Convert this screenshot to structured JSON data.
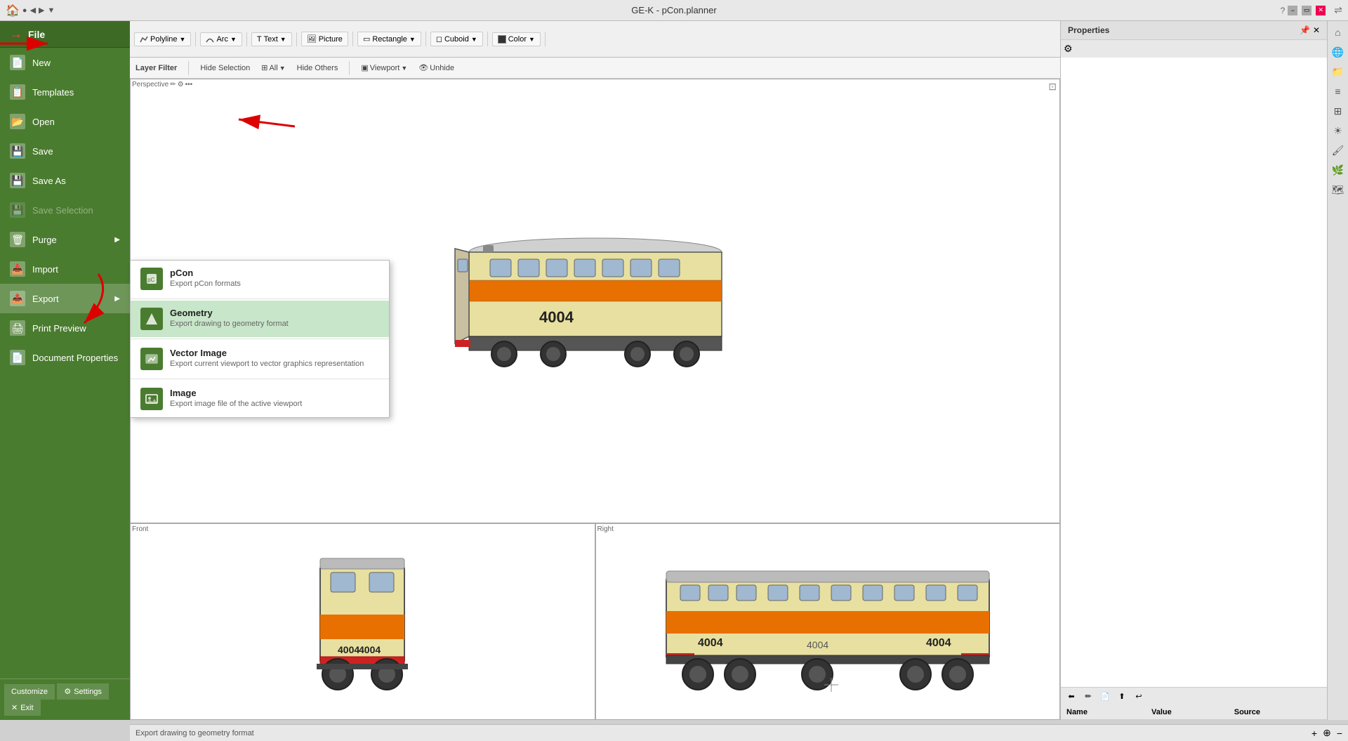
{
  "app": {
    "title": "GE-K - pCon.planner"
  },
  "titlebar": {
    "title": "GE-K - pCon.planner",
    "controls": [
      "minimize",
      "maximize",
      "close"
    ]
  },
  "file_sidebar": {
    "header": "File",
    "items": [
      {
        "id": "new",
        "label": "New",
        "icon": "📄",
        "has_arrow": false,
        "disabled": false
      },
      {
        "id": "templates",
        "label": "Templates",
        "icon": "📋",
        "has_arrow": false,
        "disabled": false
      },
      {
        "id": "open",
        "label": "Open",
        "icon": "📂",
        "has_arrow": false,
        "disabled": false
      },
      {
        "id": "save",
        "label": "Save",
        "icon": "💾",
        "has_arrow": false,
        "disabled": false
      },
      {
        "id": "save-as",
        "label": "Save As",
        "icon": "💾",
        "has_arrow": false,
        "disabled": false
      },
      {
        "id": "save-selection",
        "label": "Save Selection",
        "icon": "💾",
        "has_arrow": false,
        "disabled": true
      },
      {
        "id": "purge",
        "label": "Purge",
        "icon": "🗑",
        "has_arrow": true,
        "disabled": false
      },
      {
        "id": "import",
        "label": "Import",
        "icon": "📥",
        "has_arrow": false,
        "disabled": false
      },
      {
        "id": "export",
        "label": "Export",
        "icon": "📤",
        "has_arrow": true,
        "disabled": false,
        "active": true
      },
      {
        "id": "print-preview",
        "label": "Print Preview",
        "icon": "🖨",
        "has_arrow": false,
        "disabled": false
      },
      {
        "id": "document-properties",
        "label": "Document Properties",
        "icon": "📄",
        "has_arrow": false,
        "disabled": false
      }
    ],
    "footer": {
      "customize": "Customize",
      "settings": "Settings",
      "exit": "Exit"
    }
  },
  "export_submenu": {
    "items": [
      {
        "id": "pcon",
        "title": "pCon",
        "desc": "Export pCon formats",
        "highlighted": false
      },
      {
        "id": "geometry",
        "title": "Geometry",
        "desc": "Export drawing to geometry format",
        "highlighted": true
      },
      {
        "id": "vector-image",
        "title": "Vector Image",
        "desc": "Export current viewport to vector graphics representation",
        "highlighted": false
      },
      {
        "id": "image",
        "title": "Image",
        "desc": "Export image file of the active viewport",
        "highlighted": false
      }
    ]
  },
  "drawing_toolbar": {
    "polyline_label": "Polyline",
    "arc_label": "Arc",
    "text_label": "Text",
    "picture_label": "Picture",
    "rectangle_label": "Rectangle",
    "cuboid_label": "Cuboid",
    "color_label": "Color"
  },
  "layer_bar": {
    "layer_filter": "Layer Filter",
    "hide_selection": "Hide Selection",
    "all_label": "All",
    "hide_others": "Hide Others",
    "viewport_label": "Viewport",
    "unhide_label": "Unhide"
  },
  "properties_panel": {
    "title": "Properties",
    "columns": [
      "Name",
      "Value",
      "Source"
    ]
  },
  "viewports": {
    "top_label": "Perspective",
    "bottom_left_label": "Front",
    "bottom_right_label": "Right"
  },
  "statusbar": {
    "text": "Export drawing to geometry format"
  }
}
